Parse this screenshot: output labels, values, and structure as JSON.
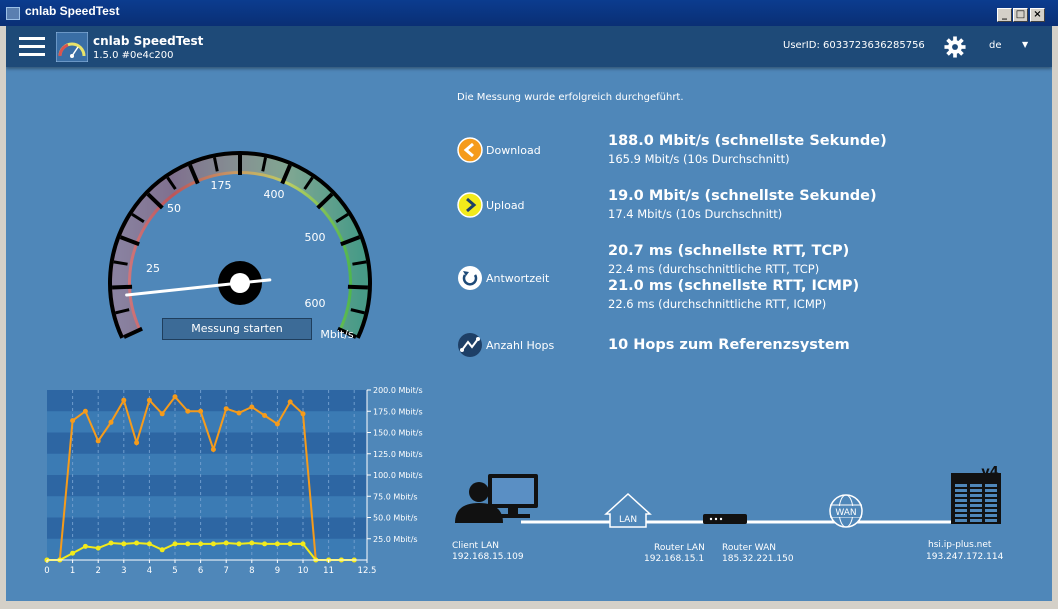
{
  "window": {
    "title": "cnlab SpeedTest"
  },
  "header": {
    "app_name": "cnlab SpeedTest",
    "version": "1.5.0 #0e4c200",
    "user_id": "UserID: 6033723636285756",
    "language": "de"
  },
  "gauge": {
    "ticks": [
      "25",
      "50",
      "175",
      "400",
      "500",
      "600"
    ],
    "unit": "Mbit/s",
    "needle_value_mbit": 10,
    "start_button": "Messung starten"
  },
  "results": {
    "status": "Die Messung wurde erfolgreich durchgeführt.",
    "download": {
      "label": "Download",
      "main": "188.0 Mbit/s (schnellste Sekunde)",
      "sub": "165.9 Mbit/s (10s Durchschnitt)"
    },
    "upload": {
      "label": "Upload",
      "main": "19.0 Mbit/s (schnellste Sekunde)",
      "sub": "17.4 Mbit/s (10s Durchschnitt)"
    },
    "latency": {
      "label": "Antwortzeit",
      "tcp_main": "20.7 ms (schnellste RTT, TCP)",
      "tcp_sub": "22.4 ms (durchschnittliche RTT, TCP)",
      "icmp_main": "21.0 ms (schnellste RTT, ICMP)",
      "icmp_sub": "22.6 ms (durchschnittliche RTT, ICMP)"
    },
    "hops": {
      "label": "Anzahl Hops",
      "main": "10 Hops zum Referenzsystem"
    }
  },
  "network": {
    "lan_icon_text": "LAN",
    "wan_icon_text": "WAN",
    "server_badge": "v4",
    "client_name": "Client LAN",
    "client_ip": "192.168.15.109",
    "router_lan_name": "Router LAN",
    "router_lan_ip": "192.168.15.1",
    "router_wan_name": "Router WAN",
    "router_wan_ip": "185.32.221.150",
    "server_name": "hsi.ip-plus.net",
    "server_ip": "193.247.172.114"
  },
  "colors": {
    "download": "#f59b1b",
    "upload": "#f2ea1b",
    "background": "#4f87b9",
    "header": "#1e4a78"
  },
  "chart_data": {
    "type": "line",
    "x_ticks": [
      "0",
      "1",
      "2",
      "3",
      "4",
      "5",
      "6",
      "7",
      "8",
      "9",
      "10",
      "11",
      "12.5"
    ],
    "y_ticks": [
      "200.0 Mbit/s",
      "175.0 Mbit/s",
      "150.0 Mbit/s",
      "125.0 Mbit/s",
      "100.0 Mbit/s",
      "75.0 Mbit/s",
      "50.0 Mbit/s",
      "25.0 Mbit/s"
    ],
    "xlim": [
      0,
      12.5
    ],
    "ylim": [
      0,
      200
    ],
    "grid": true,
    "series": [
      {
        "x": [
          0,
          0.5,
          1,
          1.5,
          2,
          2.5,
          3,
          3.5,
          4,
          4.5,
          5,
          5.5,
          6,
          6.5,
          7,
          7.5,
          8,
          8.5,
          9,
          9.5,
          10,
          10.5,
          11,
          11.5,
          12
        ],
        "values": [
          0,
          0,
          164,
          175,
          140,
          162,
          188,
          138,
          188,
          172,
          192,
          175,
          175,
          130,
          178,
          173,
          180,
          170,
          160,
          186,
          172,
          0,
          0,
          0,
          0
        ]
      },
      {
        "x": [
          0,
          0.5,
          1,
          1.5,
          2,
          2.5,
          3,
          3.5,
          4,
          4.5,
          5,
          5.5,
          6,
          6.5,
          7,
          7.5,
          8,
          8.5,
          9,
          9.5,
          10,
          10.5,
          11,
          11.5,
          12
        ],
        "values": [
          0,
          0,
          8,
          16,
          14,
          20,
          19,
          20,
          19,
          12,
          19,
          19,
          19,
          19,
          20,
          19,
          20,
          19,
          19,
          19,
          19,
          0,
          0,
          0,
          0
        ]
      }
    ]
  }
}
